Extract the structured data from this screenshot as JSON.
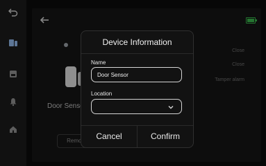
{
  "main": {
    "sensor_title": "Door Sensor",
    "remove_label": "Remove",
    "right_rows": [
      "Close",
      "Close",
      "Tamper alarm"
    ]
  },
  "modal": {
    "title": "Device Information",
    "name_label": "Name",
    "name_value": "Door Sensor",
    "location_label": "Location",
    "location_value": "",
    "cancel_label": "Cancel",
    "confirm_label": "Confirm"
  },
  "icons": {
    "rail": [
      "undo-icon",
      "devices-icon",
      "log-icon",
      "alarm-bell-icon",
      "home-icon"
    ],
    "header": [
      "back-arrow-icon",
      "battery-icon"
    ]
  },
  "colors": {
    "battery": "#38b24a"
  }
}
